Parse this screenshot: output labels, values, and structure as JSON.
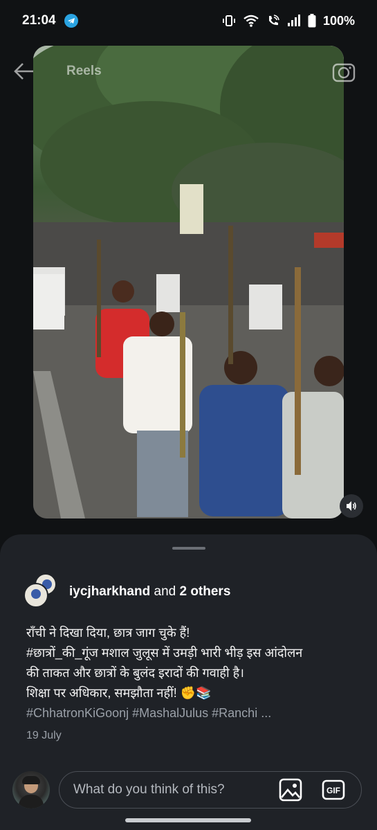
{
  "status_bar": {
    "time": "21:04",
    "battery": "100%",
    "icons": [
      "telegram-icon",
      "vibrate-icon",
      "wifi-icon",
      "wifi-call-icon",
      "signal-icon",
      "battery-icon"
    ]
  },
  "top_nav": {
    "title": "Reels",
    "back_icon": "arrow-left-icon",
    "camera_icon": "camera-icon"
  },
  "reel": {
    "volume_icon": "speaker-icon"
  },
  "post": {
    "author_handle": "iycjharkhand",
    "author_suffix": " and ",
    "others": "2 others",
    "caption_lines": [
      "राँची ने दिखा दिया, छात्र जाग चुके हैं!",
      "#छात्रों_की_गूंज मशाल जुलूस में उमड़ी भारी भीड़ इस आंदोलन",
      "की ताकत और छात्रों के बुलंद इरादों की गवाही है।",
      "शिक्षा पर अधिकार, समझौता नहीं! ✊📚",
      "#ChhatronKiGoonj #MashalJulus #Ranchi ..."
    ],
    "date": "19 July"
  },
  "comment": {
    "placeholder": "What do you think of this?",
    "gif_label": "GIF",
    "image_icon": "image-icon"
  },
  "colors": {
    "background": "#101214",
    "sheet": "#1f2227",
    "muted_text": "#9aa0a8",
    "telegram": "#2aa3e1"
  }
}
